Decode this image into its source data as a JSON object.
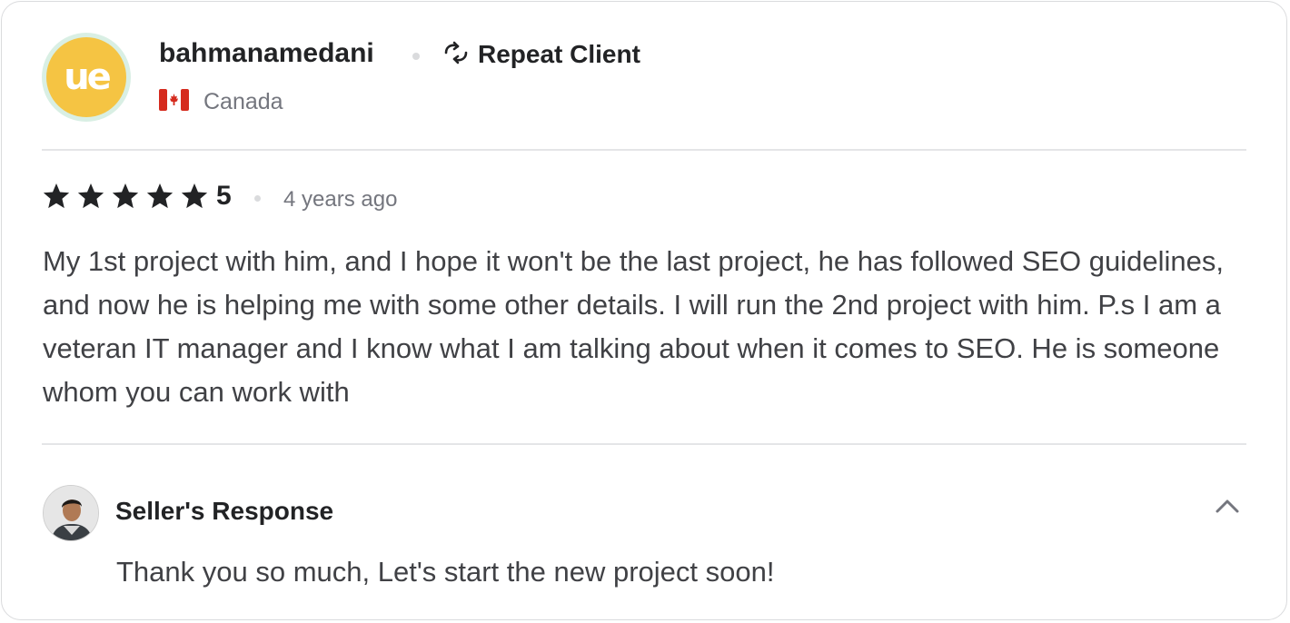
{
  "reviewer": {
    "username": "bahmanamedani",
    "avatar_text": "ue",
    "badge_label": "Repeat Client",
    "badge_icon": "repeat-icon",
    "country": "Canada",
    "flag_icon": "canada-flag-icon"
  },
  "review": {
    "rating": "5",
    "rating_out_of": 5,
    "time_ago": "4 years ago",
    "text": "My 1st project with him, and I hope it won't be the last project, he has followed SEO guidelines, and now he is helping me with some other details. I will run the 2nd project with him. P.s I am a veteran IT manager and I know what I am talking about when it comes to SEO. He is someone whom you can work with"
  },
  "seller_response": {
    "title": "Seller's Response",
    "text": "Thank you so much, Let's start the new project soon!",
    "collapse_icon": "chevron-up-icon"
  },
  "colors": {
    "avatar_yellow": "#f5c443",
    "avatar_ring": "#d9efe4",
    "text_dark": "#222325",
    "text_body": "#404145",
    "text_muted": "#74767e",
    "divider": "#e4e5e7"
  }
}
